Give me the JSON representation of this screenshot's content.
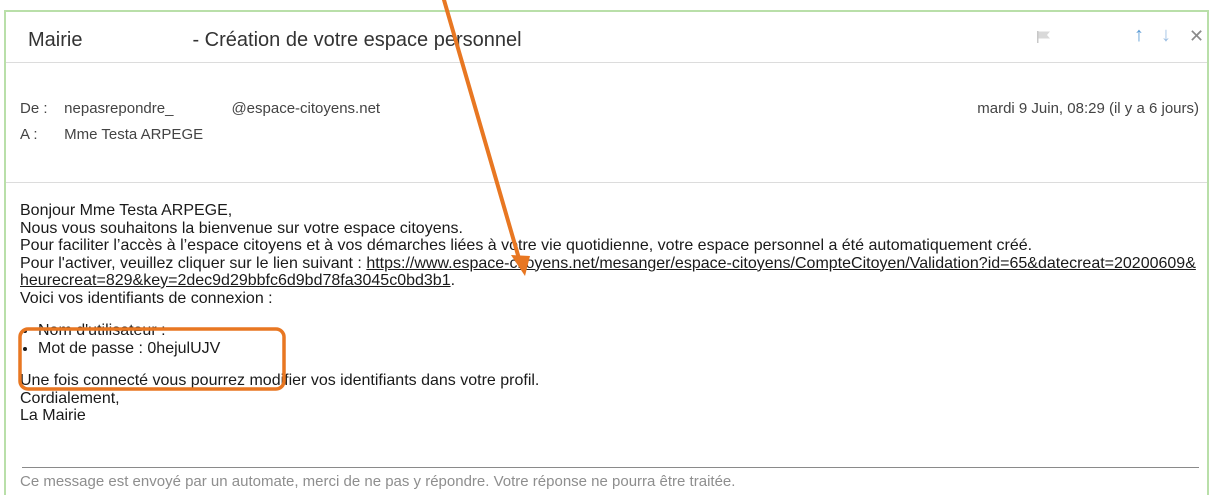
{
  "email": {
    "subject_prefix": "Mairie",
    "subject_suffix": "- Création de votre espace personnel",
    "from_label": "De :",
    "from_user": "nepasrepondre_",
    "from_domain": "@espace-citoyens.net",
    "to_label": "A :",
    "to_name": "Mme Testa ARPEGE",
    "date": "mardi 9 Juin, 08:29 (il y a 6 jours)"
  },
  "body": {
    "greeting": "Bonjour Mme Testa ARPEGE,",
    "welcome": "Nous vous souhaitons la bienvenue sur votre espace citoyens.",
    "intro": "Pour faciliter l’accès à l’espace citoyens et à vos démarches liées à votre vie quotidienne, votre espace personnel a été automatiquement créé.",
    "activate_prefix": "Pour l'activer, veuillez cliquer sur le lien suivant : ",
    "activation_link": "https://www.espace-citoyens.net/mesanger/espace-citoyens/CompteCitoyen/Validation?id=65&datecreat=20200609&heurecreat=829&key=2dec9d29bbfc6d9bd78fa3045c0bd3b1",
    "activate_suffix": ".",
    "credentials_intro": "Voici vos identifiants de connexion :",
    "username_label": "Nom d'utilisateur :",
    "password_label": "Mot de passe : 0hejulUJV",
    "profile_note": "Une fois connecté vous pourrez modifier vos identifiants dans votre profil.",
    "closing": "Cordialement,",
    "signature": "La Mairie",
    "footer": "Ce message est envoyé par un automate, merci de ne pas y répondre. Votre réponse ne pourra être traitée."
  },
  "icons": {
    "flag": "flag-icon",
    "up": "arrow-up-icon",
    "down": "arrow-down-icon",
    "close": "close-icon"
  },
  "annotation_colors": {
    "arrow": "#e87722",
    "highlight_box": "#e87722",
    "frame_border": "#b9dfa9"
  }
}
